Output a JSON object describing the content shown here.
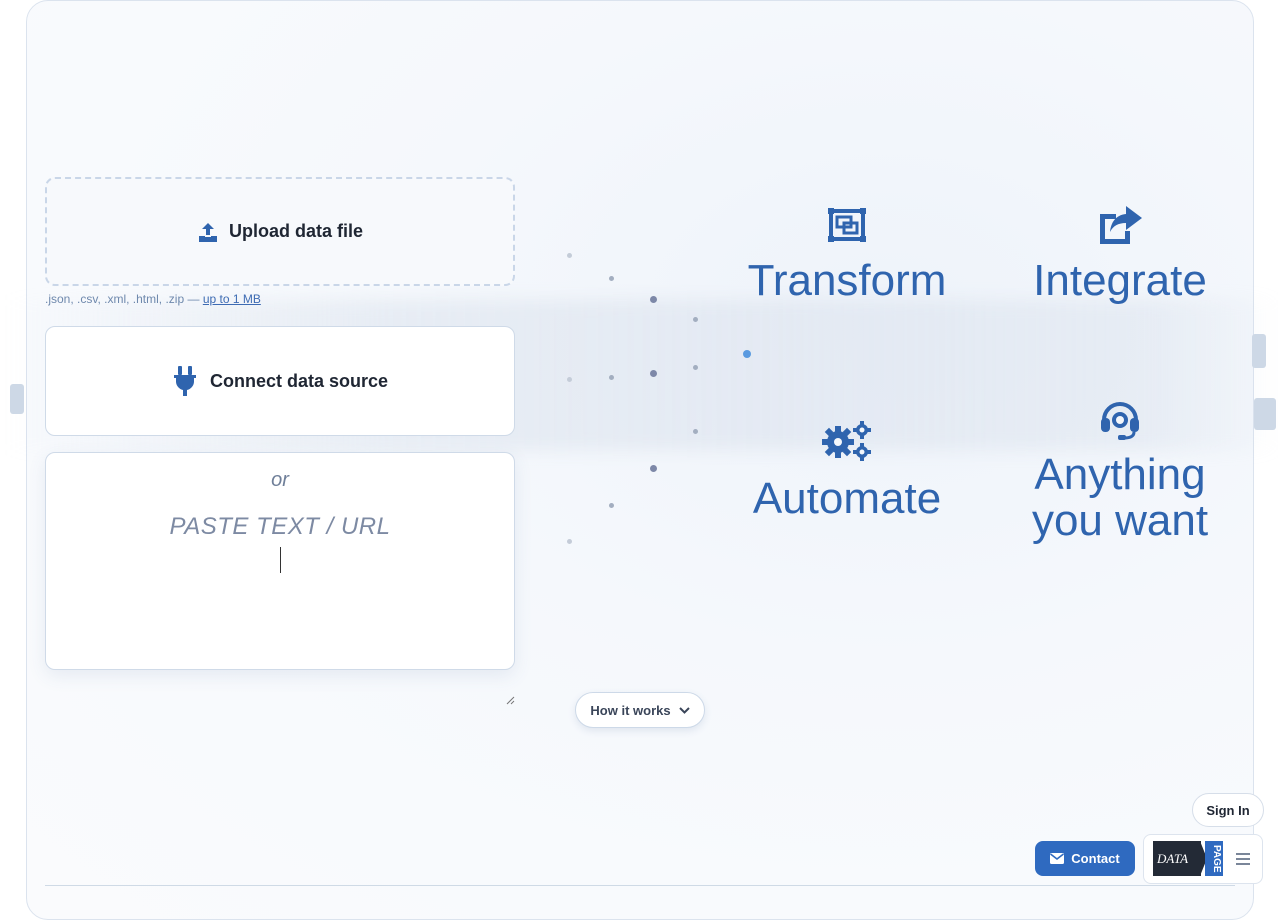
{
  "upload": {
    "label": "Upload data file",
    "icon": "upload-icon"
  },
  "hint": {
    "formats": ".json, .csv, .xml, .html, .zip — ",
    "limit": "up to 1 MB"
  },
  "connect": {
    "label": "Connect data source",
    "icon": "plug-icon"
  },
  "paste": {
    "or": "or",
    "placeholder": "PASTE TEXT / URL"
  },
  "features": [
    {
      "title": "Transform",
      "icon": "transform-icon"
    },
    {
      "title": "Integrate",
      "icon": "share-icon"
    },
    {
      "title": "Automate",
      "icon": "gears-icon"
    },
    {
      "title_line1": "Anything",
      "title_line2": "you want",
      "icon": "headset-icon"
    }
  ],
  "how_it_works": {
    "label": "How it works",
    "icon": "chevron-down-icon"
  },
  "signin": {
    "label": "Sign In"
  },
  "contact": {
    "label": "Contact",
    "icon": "envelope-icon"
  },
  "brand": {
    "word1": "DATA",
    "word2": "PAGE"
  },
  "colors": {
    "accent": "#2f64ae",
    "button": "#2f6ac0",
    "text": "#1f2633"
  }
}
